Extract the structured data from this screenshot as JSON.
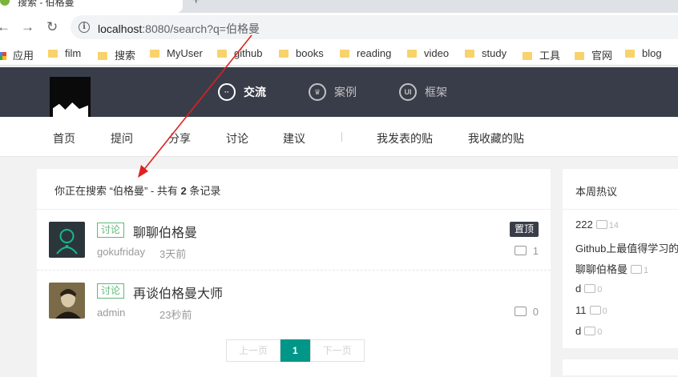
{
  "browser": {
    "tab_title": "搜索 - 伯格曼",
    "new_tab_glyph": "+",
    "url_host": "localhost",
    "url_rest": ":8080/search?q=伯格曼",
    "back_glyph": "←",
    "forward_glyph": "→",
    "reload_glyph": "↻",
    "bookmarks": [
      "应用",
      "film",
      "搜索",
      "MyUser",
      "github",
      "books",
      "reading",
      "video",
      "study",
      "工具",
      "官网",
      "blog"
    ]
  },
  "header": {
    "nav": [
      {
        "label": "交流",
        "icon": "chat-icon",
        "glyph": "··"
      },
      {
        "label": "案例",
        "icon": "crown-icon",
        "glyph": "♛"
      },
      {
        "label": "框架",
        "icon": "ui-icon",
        "glyph": "UI"
      }
    ]
  },
  "subnav": {
    "items": [
      "首页",
      "提问",
      "分享",
      "讨论",
      "建议"
    ],
    "right_items": [
      "我发表的贴",
      "我收藏的贴"
    ]
  },
  "search": {
    "prefix": "你正在搜索 “",
    "query": "伯格曼",
    "middle": "” - 共有 ",
    "count": "2",
    "suffix": " 条记录"
  },
  "posts": [
    {
      "category": "讨论",
      "title": "聊聊伯格曼",
      "author": "gokufriday",
      "time": "3天前",
      "pinned_label": "置顶",
      "comments": "1"
    },
    {
      "category": "讨论",
      "title": "再谈伯格曼大师",
      "author": "admin",
      "time": "23秒前",
      "pinned_label": "",
      "comments": "0"
    }
  ],
  "pagination": {
    "prev": "上一页",
    "current": "1",
    "next": "下一页"
  },
  "sidebar": {
    "title": "本周热议",
    "items": [
      {
        "title": "222",
        "count": "14"
      },
      {
        "title": "Github上最值得学习的",
        "count": ""
      },
      {
        "title": "聊聊伯格曼",
        "count": "1"
      },
      {
        "title": "d",
        "count": "0"
      },
      {
        "title": "11",
        "count": "0"
      },
      {
        "title": "d",
        "count": "0"
      }
    ]
  },
  "colors": {
    "accent": "#009688",
    "header_bg": "#393d49",
    "badge": "#5fb878",
    "annotation": "#e02020"
  }
}
